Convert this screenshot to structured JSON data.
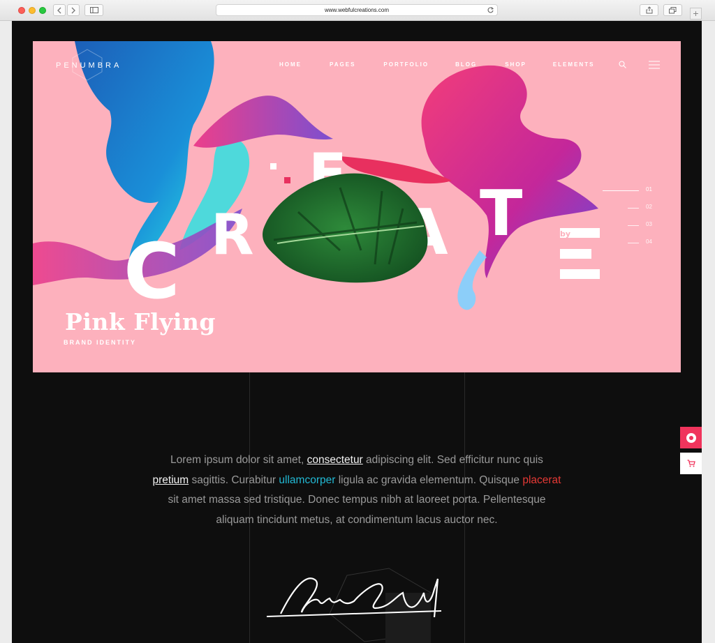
{
  "browser": {
    "url": "www.webfulcreations.com"
  },
  "site": {
    "brand": "PENUMBRA",
    "menu": [
      "HOME",
      "PAGES",
      "PORTFOLIO",
      "BLOG",
      "SHOP",
      "ELEMENTS"
    ],
    "icons": {
      "search": "search-icon",
      "menu": "hamburger-icon",
      "help": "life-ring-icon",
      "cart": "cart-icon"
    }
  },
  "hero": {
    "art_text": "CREATE",
    "art_by": "by",
    "title": "Pink Flying",
    "subtitle": "BRAND IDENTITY",
    "slides": [
      "01",
      "02",
      "03",
      "04"
    ],
    "active_slide": "01",
    "background_color": "#fdb1bd"
  },
  "content": {
    "paragraph": {
      "p1": "Lorem ipsum dolor sit amet, ",
      "link1": "consectetur",
      "p2": " adipiscing elit. Sed efficitur nunc quis ",
      "link2": "pretium",
      "p3": " sagittis. Curabitur ",
      "link3": "ullamcorper",
      "p4": " ligula ac gravida elementum. Quisque ",
      "link4": "placerat",
      "p5": " sit amet massa sed tristique. Donec tempus nibh at laoreet porta. Pellentesque aliquam tincidunt metus, at condimentum lacus auctor nec."
    }
  },
  "colors": {
    "accent_pink": "#f0345c",
    "link_cyan": "#22b9d4",
    "link_red": "#e53935",
    "dark_bg": "#0e0e0e"
  }
}
